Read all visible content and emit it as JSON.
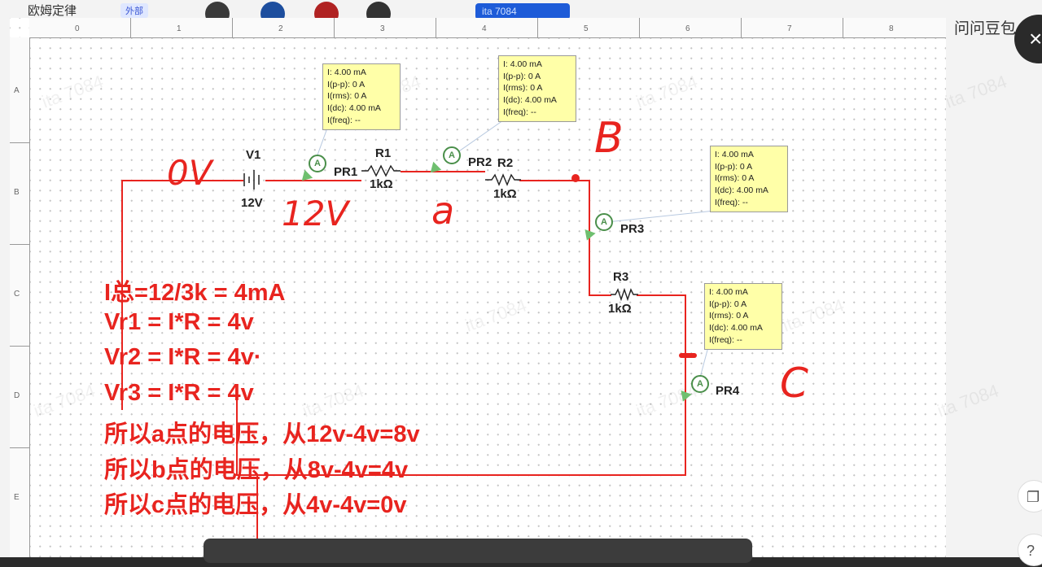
{
  "app": {
    "top_left_text": "欧姆定律",
    "tag_label": "外部",
    "blue_pill_label": "ita 7084",
    "right_panel_text": "问问豆包",
    "close_label": "×"
  },
  "ruler": {
    "columns": [
      "0",
      "1",
      "2",
      "3",
      "4",
      "5",
      "6",
      "7",
      "8"
    ],
    "rows": [
      "A",
      "B",
      "C",
      "D",
      "E"
    ]
  },
  "components": {
    "battery": {
      "name": "V1",
      "value": "12V"
    },
    "r1": {
      "name": "R1",
      "value": "1kΩ"
    },
    "r2": {
      "name": "R2",
      "value": "1kΩ"
    },
    "r3": {
      "name": "R3",
      "value": "1kΩ"
    },
    "probes": [
      "PR1",
      "PR2",
      "PR3",
      "PR4"
    ],
    "probe_symbol": "A"
  },
  "tooltips": [
    {
      "lines": [
        "I: 4.00 mA",
        "I(p-p): 0 A",
        "I(rms): 0 A",
        "I(dc): 4.00 mA",
        "I(freq): --"
      ]
    },
    {
      "lines": [
        "I: 4.00 mA",
        "I(p-p): 0 A",
        "I(rms): 0 A",
        "I(dc): 4.00 mA",
        "I(freq): --"
      ]
    },
    {
      "lines": [
        "I: 4.00 mA",
        "I(p-p): 0 A",
        "I(rms): 0 A",
        "I(dc): 4.00 mA",
        "I(freq): --"
      ]
    },
    {
      "lines": [
        "I: 4.00 mA",
        "I(p-p): 0 A",
        "I(rms): 0 A",
        "I(dc): 4.00 mA",
        "I(freq): --"
      ]
    }
  ],
  "handwriting": {
    "zero_v": "0V",
    "twelve_v": "12V",
    "a_mark": "a",
    "b_mark": "B",
    "c_mark": "C"
  },
  "equations": [
    "I总=12/3k = 4mA",
    "Vr1 = I*R = 4v",
    "Vr2 = I*R = 4v·",
    "Vr3 = I*R = 4v",
    "所以a点的电压，从12v-4v=8v",
    "所以b点的电压，从8v-4v=4v",
    "所以c点的电压，从4v-4v=0v"
  ],
  "watermark": "ita 7084",
  "colors": {
    "wire": "#e8241f",
    "annotation": "#e8241f",
    "probe": "#4a8f4a",
    "tooltip_bg": "#ffffa8"
  }
}
